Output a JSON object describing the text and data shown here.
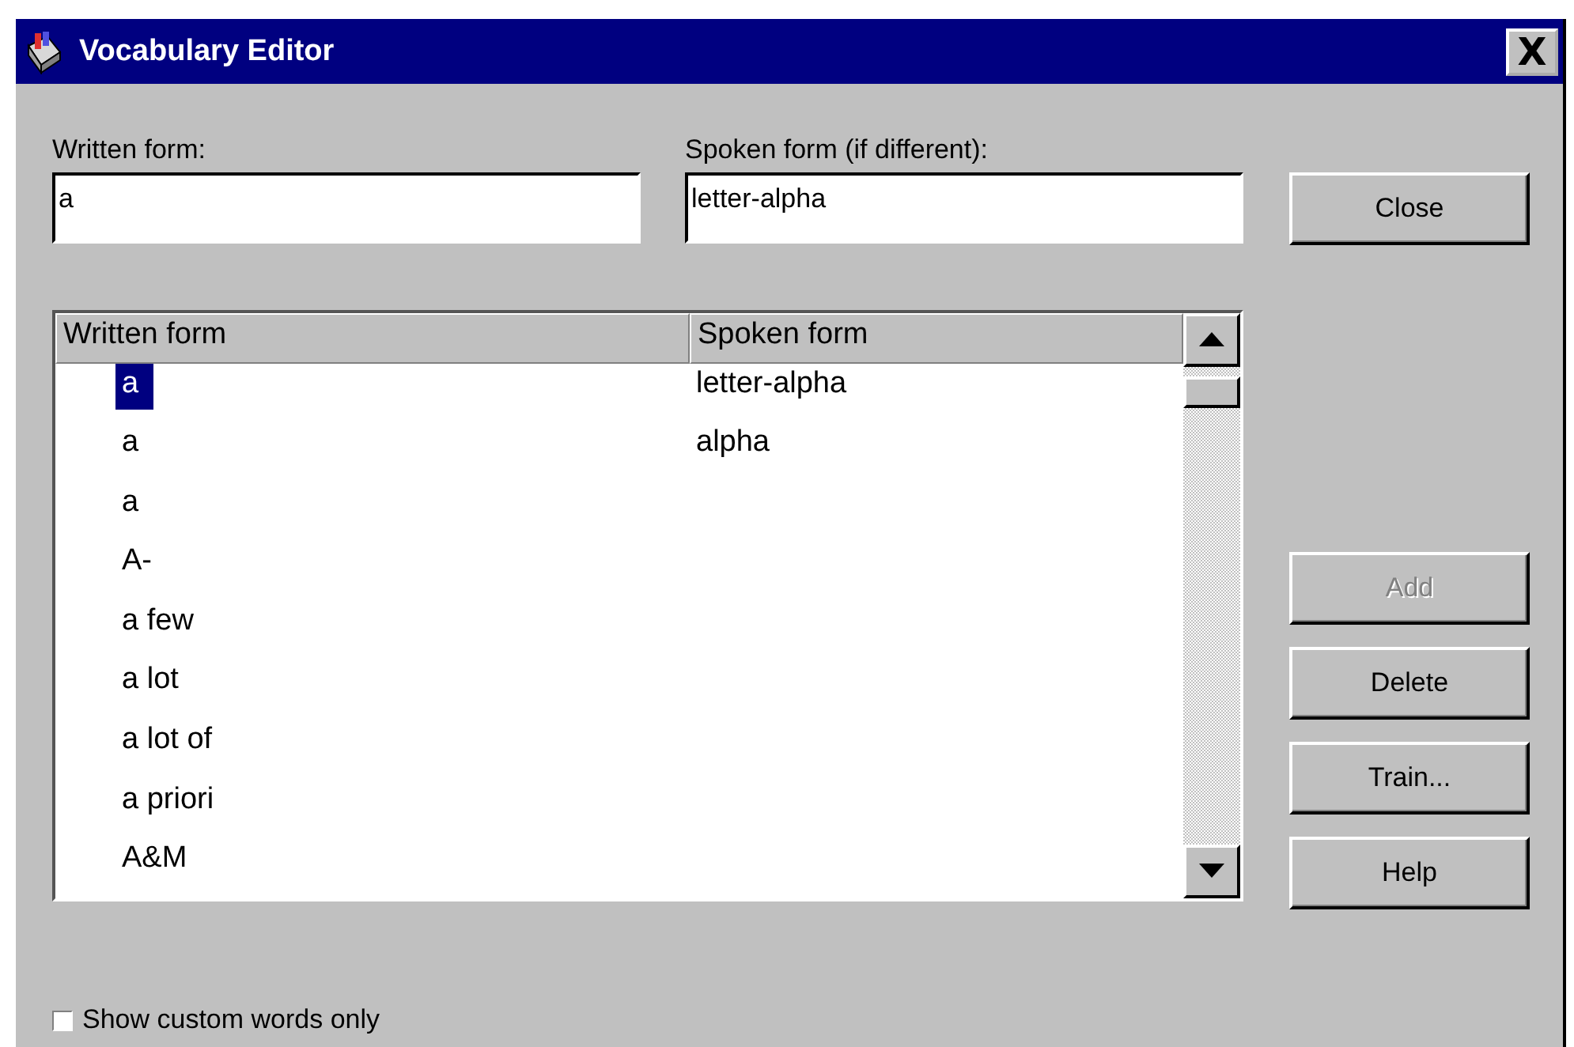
{
  "window": {
    "title": "Vocabulary Editor",
    "close_glyph": "X"
  },
  "written_field": {
    "label": "Written form:",
    "value": "a"
  },
  "spoken_field": {
    "label": "Spoken form (if different):",
    "value": "letter-alpha"
  },
  "table": {
    "columns": [
      "Written form",
      "Spoken form"
    ],
    "rows": [
      {
        "written": "a",
        "spoken": "letter-alpha",
        "selected": true
      },
      {
        "written": "a",
        "spoken": "alpha",
        "selected": false
      },
      {
        "written": "a",
        "selected": false
      },
      {
        "written": "A-",
        "selected": false
      },
      {
        "written": "a few",
        "selected": false
      },
      {
        "written": "a lot",
        "selected": false
      },
      {
        "written": "a lot of",
        "selected": false
      },
      {
        "written": "a priori",
        "selected": false
      },
      {
        "written": "A&M",
        "selected": false
      }
    ]
  },
  "buttons": [
    {
      "label": "Close",
      "disabled": false
    },
    {
      "label": "Add",
      "disabled": true
    },
    {
      "label": "Delete",
      "disabled": false
    },
    {
      "label": "Train...",
      "disabled": false
    },
    {
      "label": "Help",
      "disabled": false
    }
  ],
  "checkbox": {
    "label": "Show custom words only",
    "checked": false
  }
}
